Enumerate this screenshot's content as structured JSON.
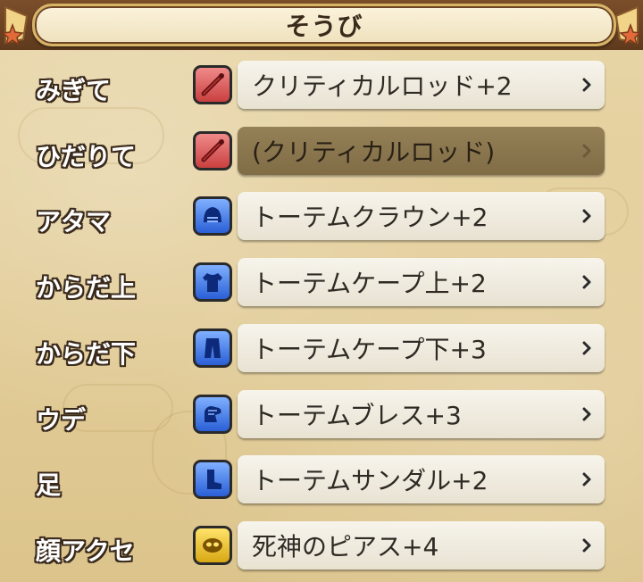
{
  "header": {
    "title": "そうび"
  },
  "equipment": [
    {
      "slot": "みぎて",
      "item": "クリティカルロッド+2",
      "icon": "rod-icon",
      "icon_color": "#d9534f",
      "disabled": false
    },
    {
      "slot": "ひだりて",
      "item": "(クリティカルロッド)",
      "icon": "rod-icon",
      "icon_color": "#d9534f",
      "disabled": true
    },
    {
      "slot": "アタマ",
      "item": "トーテムクラウン+2",
      "icon": "helmet-icon",
      "icon_color": "#2f6bd9",
      "disabled": false
    },
    {
      "slot": "からだ上",
      "item": "トーテムケープ上+2",
      "icon": "shirt-icon",
      "icon_color": "#2f6bd9",
      "disabled": false
    },
    {
      "slot": "からだ下",
      "item": "トーテムケープ下+3",
      "icon": "pants-icon",
      "icon_color": "#2f6bd9",
      "disabled": false
    },
    {
      "slot": "ウデ",
      "item": "トーテムブレス+3",
      "icon": "gauntlet-icon",
      "icon_color": "#2f6bd9",
      "disabled": false
    },
    {
      "slot": "足",
      "item": "トーテムサンダル+2",
      "icon": "boot-icon",
      "icon_color": "#2f6bd9",
      "disabled": false
    },
    {
      "slot": "顔アクセ",
      "item": "死神のピアス+4",
      "icon": "mask-icon",
      "icon_color": "#e0b21c",
      "disabled": false
    }
  ],
  "colors": {
    "header_bg": "#6b4424",
    "parchment": "#e2cc97",
    "button": "#efeadc",
    "button_disabled": "#8b774e"
  }
}
